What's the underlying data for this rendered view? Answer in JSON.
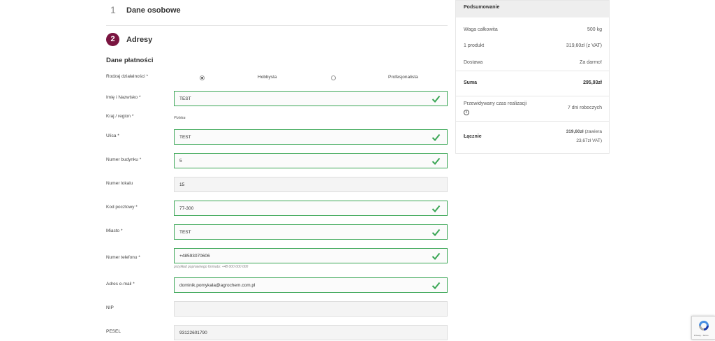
{
  "steps": {
    "step1": {
      "number": "1",
      "title": "Dane osobowe"
    },
    "step2": {
      "number": "2",
      "title": "Adresy"
    }
  },
  "form": {
    "section_title": "Dane płatności",
    "activity_type": {
      "label": "Rodzaj działalności *",
      "options": [
        "Hobbysta",
        "Profesjonalista"
      ],
      "selected": "Hobbysta"
    },
    "fields": {
      "name": {
        "label": "Imię i Nazwisko *",
        "value": "TEST"
      },
      "country": {
        "label": "Kraj / region *",
        "value": "Polska"
      },
      "street": {
        "label": "Ulica *",
        "value": "TEST"
      },
      "building": {
        "label": "Numer budynku *",
        "value": "5"
      },
      "apartment": {
        "label": "Numer lokalu",
        "value": "15"
      },
      "postal": {
        "label": "Kod pocztowy *",
        "value": "77-300"
      },
      "city": {
        "label": "Miasto *",
        "value": "TEST"
      },
      "phone": {
        "label": "Numer telefonu *",
        "value": "+48593070606",
        "hint": "przykład poprawnego formatu: +48 000 000 000"
      },
      "email": {
        "label": "Adres e-mail *",
        "value": "dominik.pomykala@agrochem.com.pl"
      },
      "nip": {
        "label": "NIP",
        "value": ""
      },
      "pesel": {
        "label": "PESEL",
        "value": "93122601790"
      }
    }
  },
  "summary": {
    "title": "Podsumowanie",
    "weight_label": "Waga całkowita",
    "weight_value": "500 kg",
    "product_label": "1 produkt",
    "product_value": "319,60zł (z VAT)",
    "delivery_label": "Dostawa",
    "delivery_value": "Za darmo!",
    "sum_label": "Suma",
    "sum_value": "295,93zł",
    "time_label": "Przewidywany czas realizacji",
    "time_value": "7 dni roboczych",
    "total_label": "Łącznie",
    "total_value": "319,60zł",
    "total_vat_1": "(zawiera",
    "total_vat_2": "23,67zł VAT)"
  },
  "colors": {
    "step_active": "#7a1440",
    "valid_border": "#3aa655"
  },
  "icons": {
    "valid": "check-icon",
    "info": "info-icon",
    "recaptcha": "recaptcha-logo-icon"
  },
  "recaptcha": {
    "text": "Privacy - Terms"
  }
}
